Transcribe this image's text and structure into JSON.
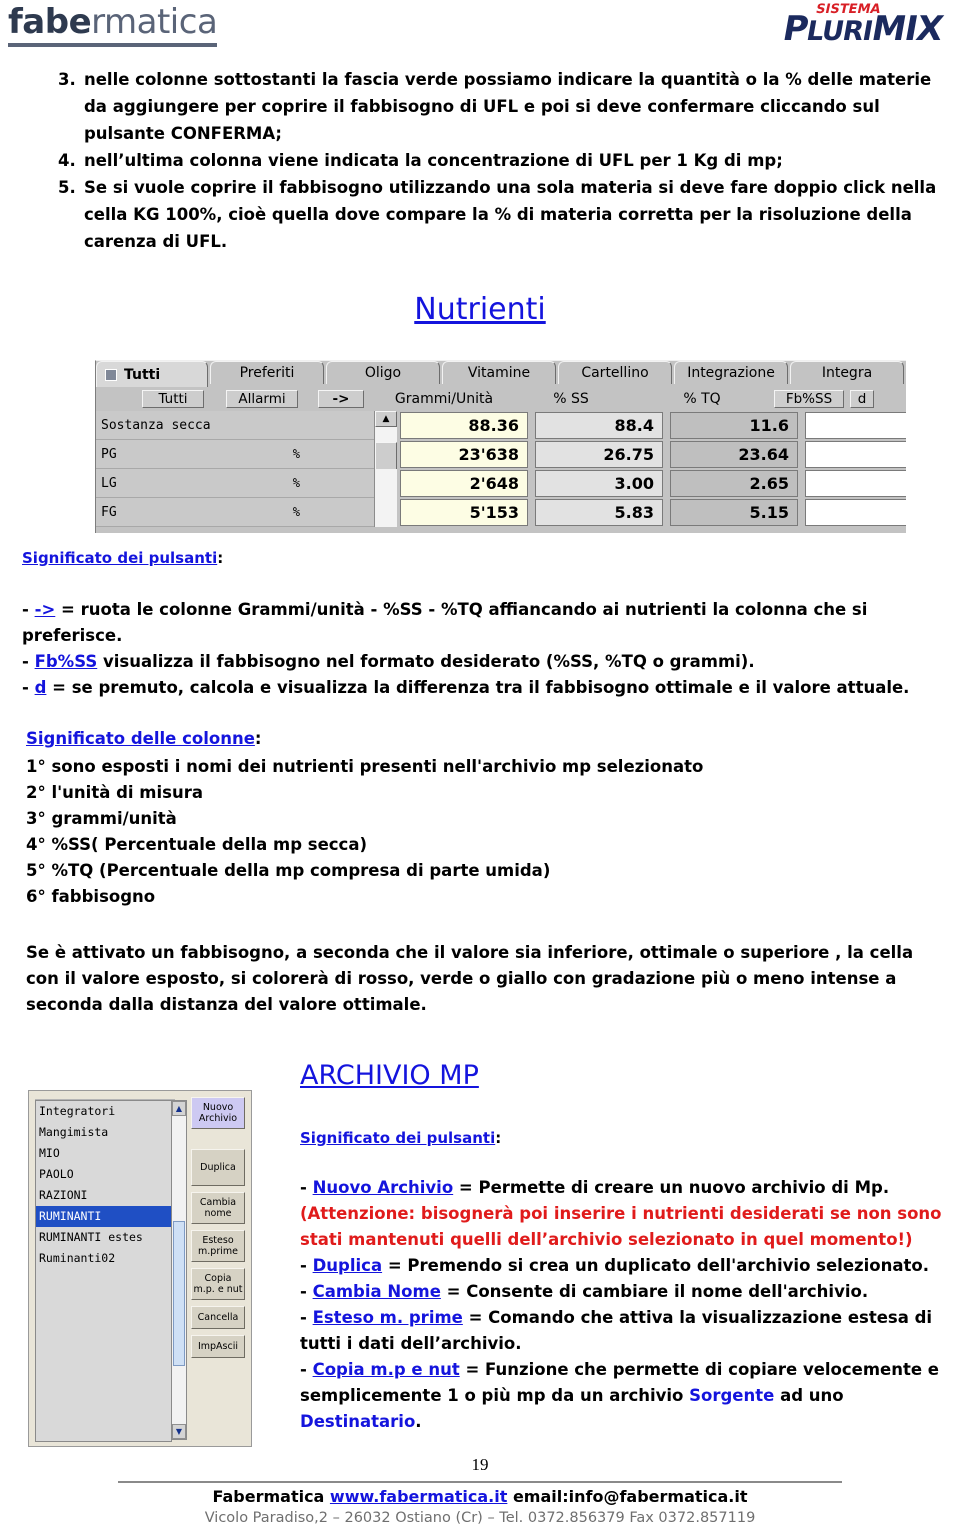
{
  "header": {
    "brand_left": "fabermatica",
    "brand_left_bold_part": "fabe",
    "brand_left_rest": "rmatica",
    "plurimix_sistema": "SISTEMA",
    "plurimix_p": "P",
    "plurimix_luri": "LURI",
    "plurimix_mix": "MIX",
    "color_brand_navy": "#1b2a5e",
    "color_brand_red": "#d81f26",
    "color_fabermatica": "#4a5568"
  },
  "instructions": [
    {
      "num": "3.",
      "text": "nelle colonne sottostanti la fascia verde possiamo indicare la quantità o la % delle materie da aggiungere per coprire il fabbisogno di UFL e poi si deve confermare cliccando sul pulsante CONFERMA;"
    },
    {
      "num": "4.",
      "text": "nell’ultima colonna viene indicata la concentrazione di UFL per 1 Kg di mp;"
    },
    {
      "num": "5.",
      "text": "Se si vuole coprire il fabbisogno utilizzando una sola materia si deve fare doppio click nella cella KG 100%, cioè quella dove compare la % di materia corretta per la risoluzione della carenza di UFL."
    }
  ],
  "nutrienti": {
    "title": "Nutrienti",
    "tabs": [
      {
        "label": "Tutti",
        "active": true
      },
      {
        "label": "Preferiti",
        "active": false
      },
      {
        "label": "Oligo",
        "active": false
      },
      {
        "label": "Vitamine",
        "active": false
      },
      {
        "label": "Cartellino",
        "active": false
      },
      {
        "label": "Integrazione",
        "active": false
      },
      {
        "label": "Integra",
        "active": false
      }
    ],
    "toolbar": {
      "btn_tutti": "Tutti",
      "btn_allarmi": "Allarmi",
      "btn_arrow": "->",
      "col_grammi": "Grammi/Unità",
      "col_ss": "% SS",
      "col_tq": "% TQ",
      "btn_fbss": "Fb%SS",
      "btn_d": "d"
    },
    "rows": [
      {
        "label": "Sostanza secca",
        "unit": "",
        "grammi": "88.36",
        "ss": "88.4",
        "tq": "11.6",
        "fb": ""
      },
      {
        "label": "PG",
        "unit": "%",
        "grammi": "23'638",
        "ss": "26.75",
        "tq": "23.64",
        "fb": ""
      },
      {
        "label": "LG",
        "unit": "%",
        "grammi": "2'648",
        "ss": "3.00",
        "tq": "2.65",
        "fb": ""
      },
      {
        "label": "FG",
        "unit": "%",
        "grammi": "5'153",
        "ss": "5.83",
        "tq": "5.15",
        "fb": ""
      }
    ],
    "colors": {
      "grammi_cell": "#fdfde4",
      "ss_cell": "#e2e2e2",
      "tq_cell": "#bfbfbf",
      "fb_cell": "#ffffff",
      "chrome": "#c3c3c3"
    }
  },
  "pulsanti_nutrienti": {
    "heading": "Significato dei pulsanti",
    "heading_colon": ":",
    "items": [
      {
        "dash": "- ",
        "key": "->",
        "rest": " = ruota le colonne Grammi/unità - %SS - %TQ affiancando ai nutrienti la colonna che si preferisce."
      },
      {
        "dash": "- ",
        "key": "Fb%SS",
        "rest": " visualizza il fabbisogno nel formato desiderato (%SS, %TQ o grammi)."
      },
      {
        "dash": "- ",
        "key": "d",
        "rest": " = se premuto, calcola e visualizza la differenza tra il fabbisogno ottimale e il valore attuale."
      }
    ]
  },
  "colonne": {
    "heading": "Significato delle colonne",
    "heading_colon": ":",
    "items": [
      "1° sono esposti i nomi dei nutrienti presenti nell'archivio mp selezionato",
      "2° l'unità di misura",
      "3°  grammi/unità",
      "4° %SS( Percentuale della mp secca)",
      "5°  %TQ (Percentuale della mp compresa di parte umida)",
      "6° fabbisogno"
    ]
  },
  "colori_paragraph": "Se è attivato un fabbisogno, a seconda che il valore sia inferiore, ottimale o superiore , la cella con il valore esposto, si colorerà di rosso, verde o giallo con gradazione più o meno intense a seconda dalla distanza del valore ottimale.",
  "archivio": {
    "title": "ARCHIVIO MP",
    "pulsanti_heading": "Significato dei pulsanti",
    "pulsanti_heading_colon": ":",
    "items": [
      {
        "dash": "- ",
        "key": "Nuovo Archivio",
        "rest": " = Permette di creare un nuovo archivio di Mp."
      },
      {
        "dash": "- ",
        "key": "Duplica",
        "rest": " = Premendo si crea un duplicato dell'archivio selezionato."
      },
      {
        "dash": "- ",
        "key": "Cambia Nome",
        "rest": " = Consente di cambiare il nome dell'archivio."
      },
      {
        "dash": "- ",
        "key": "Esteso m. prime",
        "rest": " = Comando che attiva la visualizzazione estesa di tutti i dati dell’archivio."
      },
      {
        "dash": "- ",
        "key": "Copia m.p e nut",
        "rest": " = Funzione che permette di copiare velocemente e semplicemente 1 o più mp da un archivio "
      }
    ],
    "warning": "(Attenzione: bisognerà poi inserire i nutrienti desiderati se non sono stati mantenuti quelli dell’archivio selezionato in quel momento!)",
    "copia_tail_sorgente": "Sorgente",
    "copia_tail_mid": " ad uno ",
    "copia_tail_dest": "Destinatario",
    "copia_tail_end": ".",
    "list_items": [
      {
        "label": "Integratori",
        "selected": false
      },
      {
        "label": "Mangimista",
        "selected": false
      },
      {
        "label": "MIO",
        "selected": false
      },
      {
        "label": "PAOLO",
        "selected": false
      },
      {
        "label": "RAZIONI",
        "selected": false
      },
      {
        "label": "RUMINANTI",
        "selected": true
      },
      {
        "label": "RUMINANTI estes",
        "selected": false
      },
      {
        "label": "Ruminanti02",
        "selected": false
      }
    ],
    "buttons": [
      {
        "line1": "Nuovo",
        "line2": "Archivio",
        "highlight": true
      },
      {
        "line1": "Duplica",
        "line2": "",
        "highlight": false
      },
      {
        "line1": "Cambia",
        "line2": "nome",
        "highlight": false
      },
      {
        "line1": "Esteso",
        "line2": "m.prime",
        "highlight": false
      },
      {
        "line1": "Copia",
        "line2": "m.p. e nut",
        "highlight": false
      },
      {
        "line1": "Cancella",
        "line2": "",
        "highlight": false
      },
      {
        "line1": "ImpAscii",
        "line2": "",
        "highlight": false
      }
    ],
    "scroll_up": "▲",
    "scroll_down": "▼"
  },
  "footer": {
    "page_number": "19",
    "company": "Fabermatica ",
    "website": "www.fabermatica.it",
    "email": " email:info@fabermatica.it",
    "address": "Vicolo Paradiso,2 – 26032 Ostiano (Cr) – Tel. 0372.856379 Fax 0372.857119"
  }
}
